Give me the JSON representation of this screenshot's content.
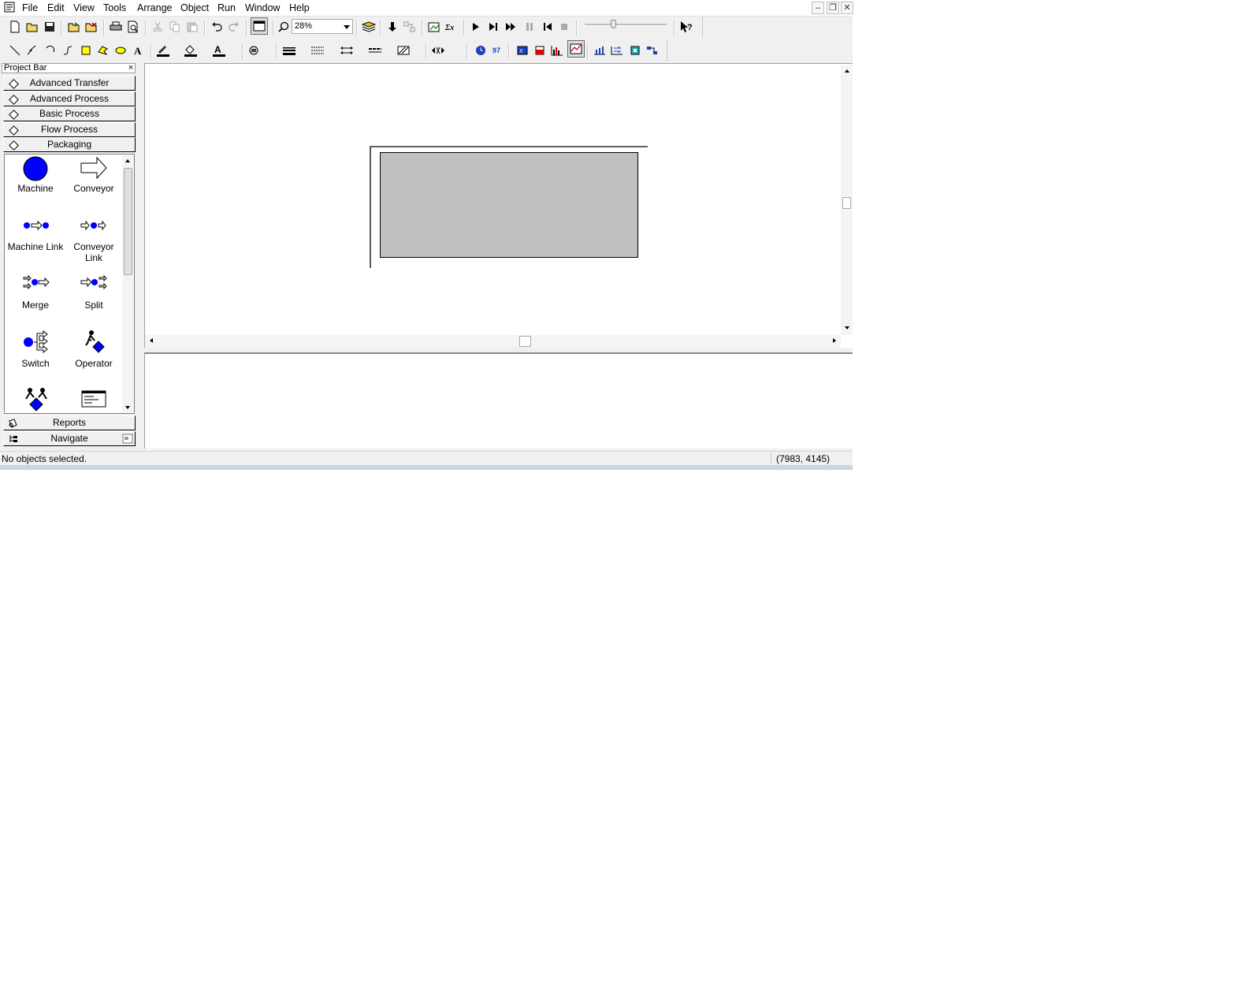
{
  "menu": [
    "File",
    "Edit",
    "View",
    "Tools",
    "Arrange",
    "Object",
    "Run",
    "Window",
    "Help"
  ],
  "window_controls": {
    "minimize": "–",
    "restore": "❐",
    "close": "✕"
  },
  "toolbar": {
    "zoom_value": "28%"
  },
  "project_bar": {
    "title": "Project Bar",
    "close": "×",
    "panels_top": [
      "Advanced Transfer",
      "Advanced Process",
      "Basic Process",
      "Flow Process",
      "Packaging"
    ],
    "shapes": [
      {
        "label": "Machine",
        "icon": "machine-icon"
      },
      {
        "label": "Conveyor",
        "icon": "conveyor-icon"
      },
      {
        "label": "Machine Link",
        "icon": "machine-link-icon"
      },
      {
        "label": "Conveyor Link",
        "icon": "conveyor-link-icon"
      },
      {
        "label": "Merge",
        "icon": "merge-icon"
      },
      {
        "label": "Split",
        "icon": "split-icon"
      },
      {
        "label": "Switch",
        "icon": "switch-icon"
      },
      {
        "label": "Operator",
        "icon": "operator-icon"
      }
    ],
    "panels_bottom": [
      "Reports",
      "Navigate"
    ]
  },
  "status": {
    "message": "No objects selected.",
    "coordinates": "(7983, 4145)"
  },
  "colors": {
    "accent_blue": "#0000ff",
    "canvas_rect_fill": "#c0c0c0"
  }
}
